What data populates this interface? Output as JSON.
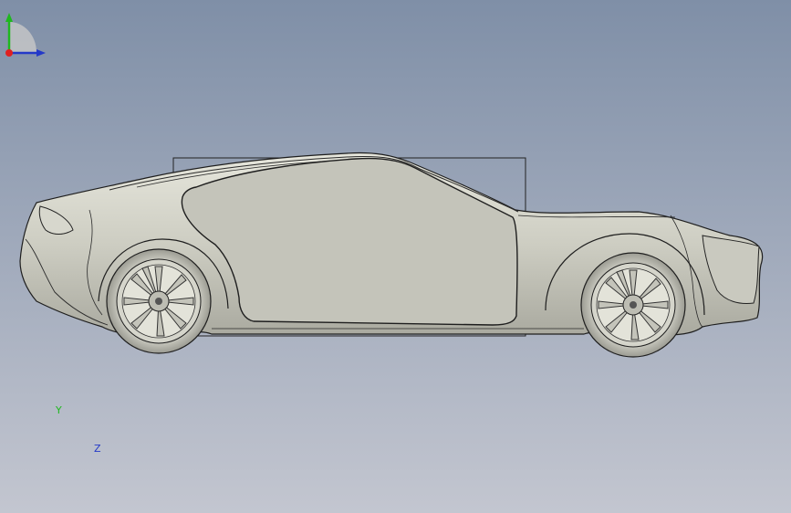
{
  "viewport": {
    "background_top": "#7f8fa7",
    "background_bottom": "#c3c6d0",
    "model": "car-side-view",
    "body_color": "#cfcfc4",
    "glass_color": "#c4c4ba",
    "edge_color": "#1e1e1e"
  },
  "triad": {
    "y_label": "Y",
    "z_label": "Z",
    "y_color": "#1fb81f",
    "z_color": "#2439c8",
    "x_color": "#e02020"
  }
}
